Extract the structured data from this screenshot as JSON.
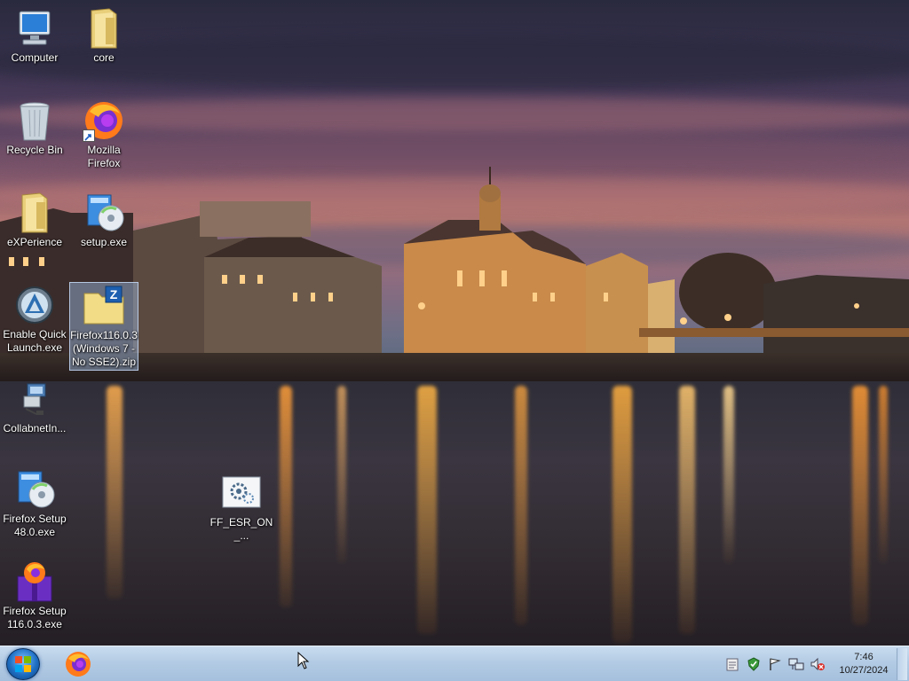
{
  "desktop": {
    "icons": [
      {
        "id": "computer",
        "label": "Computer"
      },
      {
        "id": "core",
        "label": "core"
      },
      {
        "id": "recycle",
        "label": "Recycle Bin"
      },
      {
        "id": "mozilla",
        "label": "Mozilla\nFirefox"
      },
      {
        "id": "experience",
        "label": "eXPerience"
      },
      {
        "id": "setup",
        "label": "setup.exe"
      },
      {
        "id": "quicklaunch",
        "label": "Enable Quick\nLaunch.exe"
      },
      {
        "id": "ffzip",
        "label": "Firefox116.0.3\n(Windows 7 -\nNo SSE2).zip"
      },
      {
        "id": "collabnet",
        "label": "CollabnetIn..."
      },
      {
        "id": "ffsetup48",
        "label": "Firefox Setup\n48.0.exe"
      },
      {
        "id": "ffesr",
        "label": "FF_ESR_ON_..."
      },
      {
        "id": "ffsetup116",
        "label": "Firefox Setup\n116.0.3.exe"
      }
    ]
  },
  "taskbar": {
    "clock_time": "7:46",
    "clock_date": "10/27/2024"
  },
  "colors": {
    "taskbar": "#b3cbe4",
    "selection": "#a0bee6",
    "firefox_orange": "#ff7a1a",
    "firefox_purple": "#7b2fd1"
  }
}
